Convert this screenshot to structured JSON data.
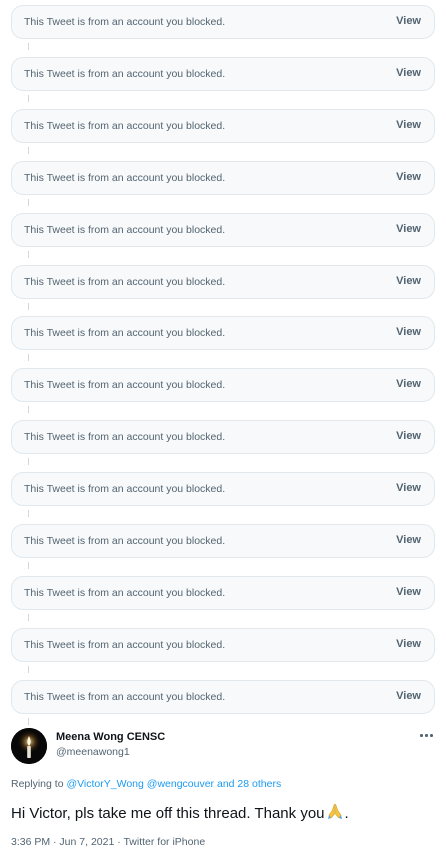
{
  "blocked_tweets": [
    {
      "text": "This Tweet is from an account you blocked.",
      "action": "View"
    },
    {
      "text": "This Tweet is from an account you blocked.",
      "action": "View"
    },
    {
      "text": "This Tweet is from an account you blocked.",
      "action": "View"
    },
    {
      "text": "This Tweet is from an account you blocked.",
      "action": "View"
    },
    {
      "text": "This Tweet is from an account you blocked.",
      "action": "View"
    },
    {
      "text": "This Tweet is from an account you blocked.",
      "action": "View"
    },
    {
      "text": "This Tweet is from an account you blocked.",
      "action": "View"
    },
    {
      "text": "This Tweet is from an account you blocked.",
      "action": "View"
    },
    {
      "text": "This Tweet is from an account you blocked.",
      "action": "View"
    },
    {
      "text": "This Tweet is from an account you blocked.",
      "action": "View"
    },
    {
      "text": "This Tweet is from an account you blocked.",
      "action": "View"
    },
    {
      "text": "This Tweet is from an account you blocked.",
      "action": "View"
    },
    {
      "text": "This Tweet is from an account you blocked.",
      "action": "View"
    },
    {
      "text": "This Tweet is from an account you blocked.",
      "action": "View"
    }
  ],
  "tweet": {
    "author": {
      "name": "Meena Wong CENSC",
      "handle": "@meenawong1",
      "avatar_icon": "candle-icon"
    },
    "more_icon": "more-horizontal-icon",
    "replying": {
      "prefix": "Replying to",
      "mentions": [
        "@VictorY_Wong",
        "@wengcouver"
      ],
      "others": "and 28 others"
    },
    "text": "Hi Victor, pls take me off this thread. Thank you",
    "text_suffix": ".",
    "emoji": "folded-hands-emoji",
    "meta": "3:36 PM · Jun 7, 2021 · Twitter for iPhone"
  },
  "colors": {
    "link": "#1d9bf0",
    "muted": "#536471",
    "card_bg": "#f7f9fa",
    "card_border": "#e1e8ed"
  }
}
